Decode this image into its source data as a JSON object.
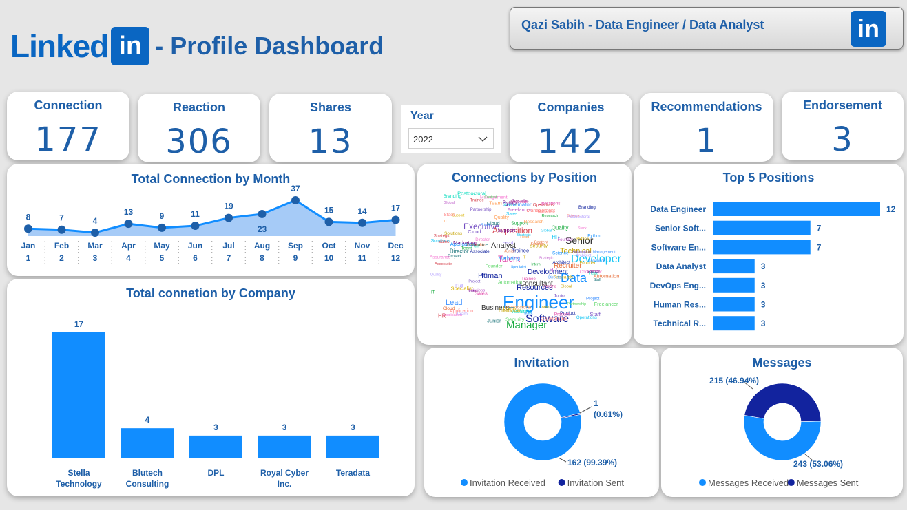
{
  "header": {
    "brand_text": "Linked",
    "brand_box": "in",
    "title": "- Profile Dashboard",
    "profile_name": "Qazi Sabih - Data Engineer / Data Analyst",
    "profile_icon": "in"
  },
  "kpis": {
    "connection": {
      "label": "Connection",
      "value": "177"
    },
    "reaction": {
      "label": "Reaction",
      "value": "306"
    },
    "shares": {
      "label": "Shares",
      "value": "13"
    },
    "companies": {
      "label": "Companies",
      "value": "142"
    },
    "recommendations": {
      "label": "Recommendations",
      "value": "1"
    },
    "endorsement": {
      "label": "Endorsement",
      "value": "3"
    }
  },
  "year_filter": {
    "label": "Year",
    "selected": "2022"
  },
  "colors": {
    "accent": "#1e5fa8",
    "bar": "#118dff",
    "dark_series": "#12239e",
    "area": "#a6cbf7"
  },
  "monthly_chart": {
    "title": "Total Connection by Month",
    "chart_data": {
      "type": "area",
      "categories": [
        "Jan",
        "Feb",
        "Mar",
        "Apr",
        "May",
        "Jun",
        "Jul",
        "Aug",
        "Sep",
        "Oct",
        "Nov",
        "Dec"
      ],
      "sub_labels": [
        "1",
        "2",
        "3",
        "4",
        "5",
        "6",
        "7",
        "8",
        "9",
        "10",
        "11",
        "12"
      ],
      "values": [
        8,
        7,
        4,
        13,
        9,
        11,
        19,
        23,
        37,
        15,
        14,
        17
      ]
    }
  },
  "company_chart": {
    "title": "Total connetion by Company",
    "chart_data": {
      "type": "bar",
      "categories": [
        [
          "Stella",
          "Technology"
        ],
        [
          "Blutech",
          "Consulting"
        ],
        [
          "DPL"
        ],
        [
          "Royal Cyber",
          "Inc."
        ],
        [
          "Teradata"
        ]
      ],
      "values": [
        17,
        4,
        3,
        3,
        3
      ]
    }
  },
  "wordcloud": {
    "title": "Connections by Position",
    "words": [
      "Engineer",
      "Data",
      "Developer",
      "Software",
      "Manager",
      "Senior",
      "Executive",
      "Acquisition",
      "Talent",
      "Analyst",
      "Technical",
      "Human",
      "Resources",
      "Consultant",
      "Specialist",
      "Recruiter",
      "Lead",
      "Associate",
      "Business",
      "Development",
      "Cloud",
      "Support",
      "Operations",
      "Project",
      "IT",
      "HR",
      "Director",
      "Team",
      "Global",
      "Management",
      "Head",
      "Founder",
      "Application",
      "Architect",
      "Security",
      "Marketing",
      "Product",
      "Automation",
      "Python",
      "Trainee",
      "Junior",
      "Intern",
      "Sales",
      "Staff",
      "Research",
      "Strategic",
      "Assurance",
      "Quality",
      "Solutions",
      "Coordinator",
      "Postdoctoral",
      "Freelancer",
      "Stack",
      "Full",
      "Content",
      "Science",
      "Branding",
      "Partnership"
    ]
  },
  "top_positions": {
    "title": "Top 5 Positions",
    "chart_data": {
      "type": "bar",
      "categories": [
        "Data Engineer",
        "Senior Soft...",
        "Software En...",
        "Data Analyst",
        "DevOps Eng...",
        "Human Res...",
        "Technical R..."
      ],
      "values": [
        12,
        7,
        7,
        3,
        3,
        3,
        3
      ]
    }
  },
  "invitation": {
    "title": "Invitation",
    "chart_data": {
      "type": "pie",
      "series": [
        {
          "name": "Invitation Received",
          "value": 162,
          "label": "162 (99.39%)"
        },
        {
          "name": "Invitation Sent",
          "value": 1,
          "label": "1",
          "label2": "(0.61%)"
        }
      ]
    }
  },
  "messages": {
    "title": "Messages",
    "chart_data": {
      "type": "pie",
      "series": [
        {
          "name": "Messages Received",
          "value": 243,
          "label": "243 (53.06%)"
        },
        {
          "name": "Messages Sent",
          "value": 215,
          "label": "215 (46.94%)"
        }
      ]
    }
  }
}
